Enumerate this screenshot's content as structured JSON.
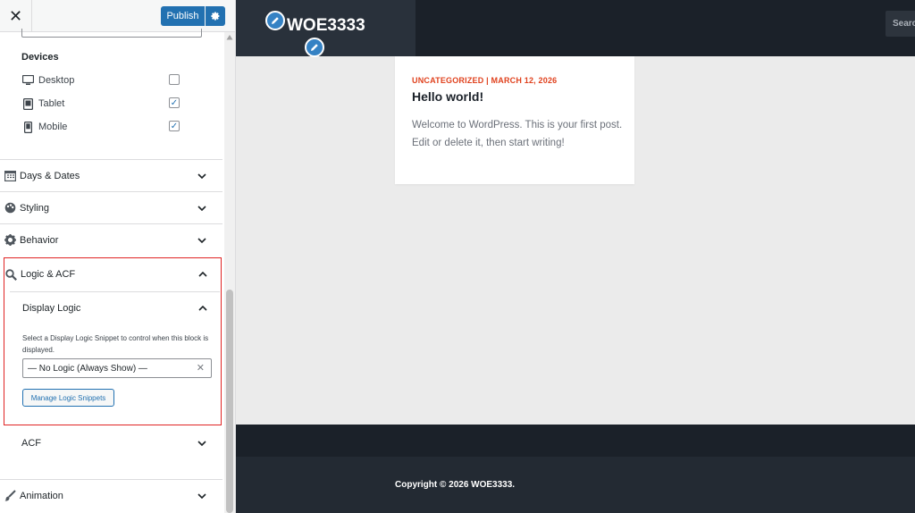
{
  "customizer": {
    "close_symbol": "✕",
    "publish_label": "Publish",
    "devices": {
      "title": "Devices",
      "items": [
        {
          "label": "Desktop",
          "checked": false
        },
        {
          "label": "Tablet",
          "checked": true
        },
        {
          "label": "Mobile",
          "checked": true
        }
      ]
    },
    "sections": {
      "days_dates": "Days & Dates",
      "styling": "Styling",
      "behavior": "Behavior",
      "logic_acf": "Logic & ACF",
      "animation": "Animation"
    },
    "logic": {
      "display_logic_title": "Display Logic",
      "help_text": "Select a Display Logic Snippet to control when this block is displayed.",
      "select_value": "— No Logic (Always Show) —",
      "clear_symbol": "✕",
      "manage_button": "Manage Logic Snippets",
      "acf_title": "ACF"
    },
    "checkmark": "✓",
    "colors": {
      "accent": "#2271b1",
      "highlight_border": "#e02424"
    }
  },
  "preview": {
    "site_title": "WOE3333",
    "search_placeholder": "Search",
    "post": {
      "meta": "UNCATEGORIZED | MARCH 12, 2026",
      "title": "Hello world!",
      "excerpt": "Welcome to WordPress. This is your first post. Edit or delete it, then start writing!"
    },
    "copyright": "Copyright © 2026 WOE3333.",
    "colors": {
      "header_bg": "#1b2129",
      "meta_color": "#e0421e",
      "pencil": "#3582c4"
    }
  }
}
